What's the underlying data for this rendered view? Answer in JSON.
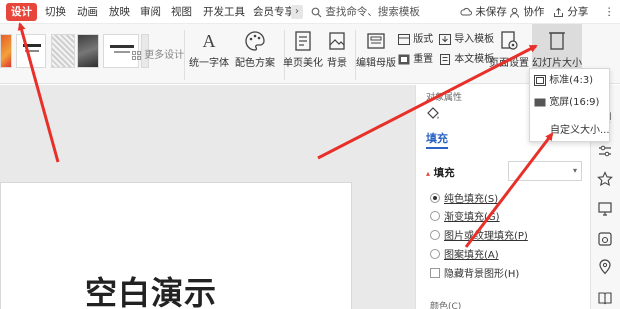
{
  "menu": {
    "items": [
      "设计",
      "切换",
      "动画",
      "放映",
      "审阅",
      "视图",
      "开发工具",
      "会员专享"
    ],
    "more": "›",
    "search_placeholder": "查找命令、搜索模板",
    "unsaved": "未保存",
    "collab": "协作",
    "share": "分享"
  },
  "ribbon": {
    "more_designs": "更多设计",
    "unify_fonts": "统一字体",
    "color_scheme": "配色方案",
    "background": "背景",
    "single_page_beautify": "单页美化",
    "edit_master": "编辑母版",
    "layout": "版式",
    "import_template": "导入模板",
    "reset": "重置",
    "text_template": "本文模板",
    "page_setup": "页面设置",
    "slide_size": "幻灯片大小"
  },
  "dropdown": {
    "standard": "标准(4:3)",
    "widescreen": "宽屏(16:9)",
    "custom": "自定义大小..."
  },
  "slide": {
    "title": "空白演示"
  },
  "panel": {
    "header": "对象属性",
    "tab": "填充",
    "section": "填充",
    "options": [
      "纯色填充(S)",
      "渐变填充(G)",
      "图片或纹理填充(P)",
      "图案填充(A)"
    ],
    "hide_bg": "隐藏背景图形(H)",
    "color_label": "颜色(C)"
  },
  "colors": {
    "accent_red": "#e8463a",
    "link_blue": "#2c64c4",
    "arrow_red": "#e8302a"
  }
}
